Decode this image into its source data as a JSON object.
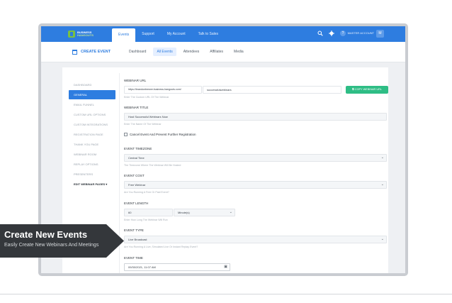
{
  "app": {
    "brand_line1": "BUSINESS",
    "brand_line2": "HANGOUTS",
    "account_label": "MASTER ACCOUNT",
    "avatar_letter": "M",
    "help_icon_char": "?"
  },
  "top_nav": [
    "Events",
    "Support",
    "My Account",
    "Talk to Sales"
  ],
  "sub_bar": {
    "create_label": "CREATE EVENT",
    "tabs": [
      "Dashboard",
      "All Events",
      "Attendees",
      "Affiliates",
      "Media"
    ]
  },
  "sidebar": {
    "items": [
      "DASHBOARD",
      "GENERAL",
      "EMAIL FUNNEL",
      "CUSTOM URL OPTIONS",
      "CUSTOM INTEGRATIONS",
      "REGISTRATION PAGE",
      "THANK YOU PAGE",
      "WEBINAR ROOM",
      "REPLAY OPTIONS",
      "PRESENTERS",
      "EDIT WEBINAR PAGES ▾"
    ]
  },
  "form": {
    "webinar_url": {
      "label": "WEBINAR URL",
      "prefix": "https://brandonbrewer.business-hangouts.com/",
      "slug": "successfulwebinars",
      "copy_label": "COPY WEBINAR URL",
      "hint": "Enter The Custom URL Of The Webinar"
    },
    "webinar_title": {
      "label": "WEBINAR TITLE",
      "value": "Host Successful Webinars Now",
      "hint": "Enter The Name Of The Webinar"
    },
    "cancel_event": {
      "label": "Cancel Event And Prevent Further Registration",
      "checked": false
    },
    "timezone": {
      "label": "EVENT TIMEZONE",
      "value": "Central Time",
      "hint": "The Timezone Where The Webinar Will Be Hosted"
    },
    "cost": {
      "label": "EVENT COST",
      "value": "Free Webinar",
      "hint": "Are You Running A Free Or Paid Event?"
    },
    "length": {
      "label": "EVENT LENGTH",
      "value": "60",
      "unit": "Minute(s)",
      "hint": "Enter How Long The Webinar Will Run"
    },
    "type": {
      "label": "EVENT TYPE",
      "value": "Live Broadcast",
      "hint": "Are You Running A Live, Simulated Live Or Instant Replay Event?"
    },
    "time": {
      "label": "EVENT TIME",
      "value": "09/30/2021, 11:07 AM"
    }
  },
  "banner": {
    "title": "Create New Events",
    "subtitle": "Easily Create New Webinars And Meetings"
  },
  "colors": {
    "primary": "#2e7de0",
    "accent_green": "#2ebd85",
    "banner_bg": "#34373b"
  }
}
